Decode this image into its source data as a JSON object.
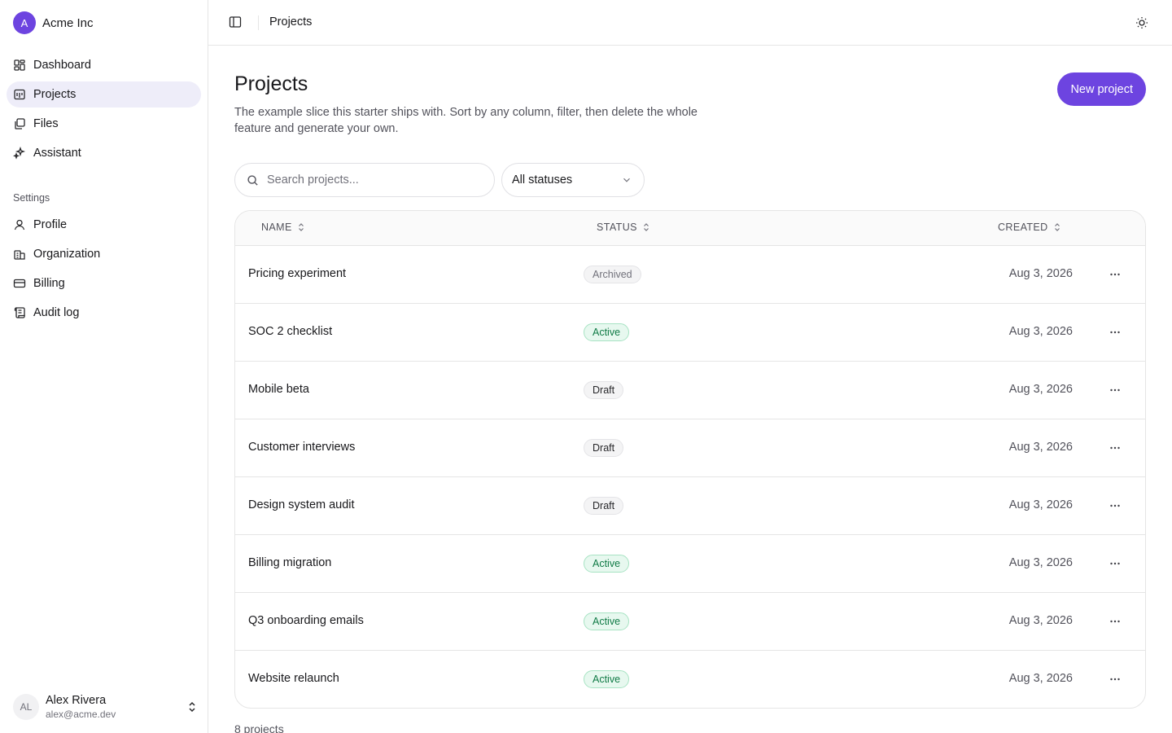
{
  "org": {
    "avatar_letter": "A",
    "name": "Acme Inc"
  },
  "nav": {
    "main": [
      {
        "label": "Dashboard",
        "icon": "dashboard-icon"
      },
      {
        "label": "Projects",
        "icon": "projects-icon",
        "active": true
      },
      {
        "label": "Files",
        "icon": "files-icon"
      },
      {
        "label": "Assistant",
        "icon": "sparkles-icon"
      }
    ],
    "settings_label": "Settings",
    "settings": [
      {
        "label": "Profile",
        "icon": "user-icon"
      },
      {
        "label": "Organization",
        "icon": "building-icon"
      },
      {
        "label": "Billing",
        "icon": "credit-card-icon"
      },
      {
        "label": "Audit log",
        "icon": "scroll-icon"
      }
    ]
  },
  "user": {
    "initials": "AL",
    "name": "Alex Rivera",
    "email": "alex@acme.dev"
  },
  "topbar": {
    "breadcrumb": "Projects"
  },
  "page": {
    "title": "Projects",
    "description": "The example slice this starter ships with. Sort by any column, filter, then delete the whole feature and generate your own.",
    "new_button": "New project"
  },
  "filters": {
    "search_placeholder": "Search projects...",
    "status_value": "All statuses"
  },
  "table": {
    "columns": {
      "name": "NAME",
      "status": "STATUS",
      "created": "CREATED"
    },
    "rows": [
      {
        "name": "Pricing experiment",
        "status": "Archived",
        "status_kind": "archived",
        "created": "Aug 3, 2026"
      },
      {
        "name": "SOC 2 checklist",
        "status": "Active",
        "status_kind": "active",
        "created": "Aug 3, 2026"
      },
      {
        "name": "Mobile beta",
        "status": "Draft",
        "status_kind": "draft",
        "created": "Aug 3, 2026"
      },
      {
        "name": "Customer interviews",
        "status": "Draft",
        "status_kind": "draft",
        "created": "Aug 3, 2026"
      },
      {
        "name": "Design system audit",
        "status": "Draft",
        "status_kind": "draft",
        "created": "Aug 3, 2026"
      },
      {
        "name": "Billing migration",
        "status": "Active",
        "status_kind": "active",
        "created": "Aug 3, 2026"
      },
      {
        "name": "Q3 onboarding emails",
        "status": "Active",
        "status_kind": "active",
        "created": "Aug 3, 2026"
      },
      {
        "name": "Website relaunch",
        "status": "Active",
        "status_kind": "active",
        "created": "Aug 3, 2026"
      }
    ]
  },
  "footer": {
    "count": "8 projects"
  },
  "colors": {
    "accent": "#6d44e0",
    "active_bg": "#e7f8ef",
    "active_text": "#0f7a45"
  }
}
